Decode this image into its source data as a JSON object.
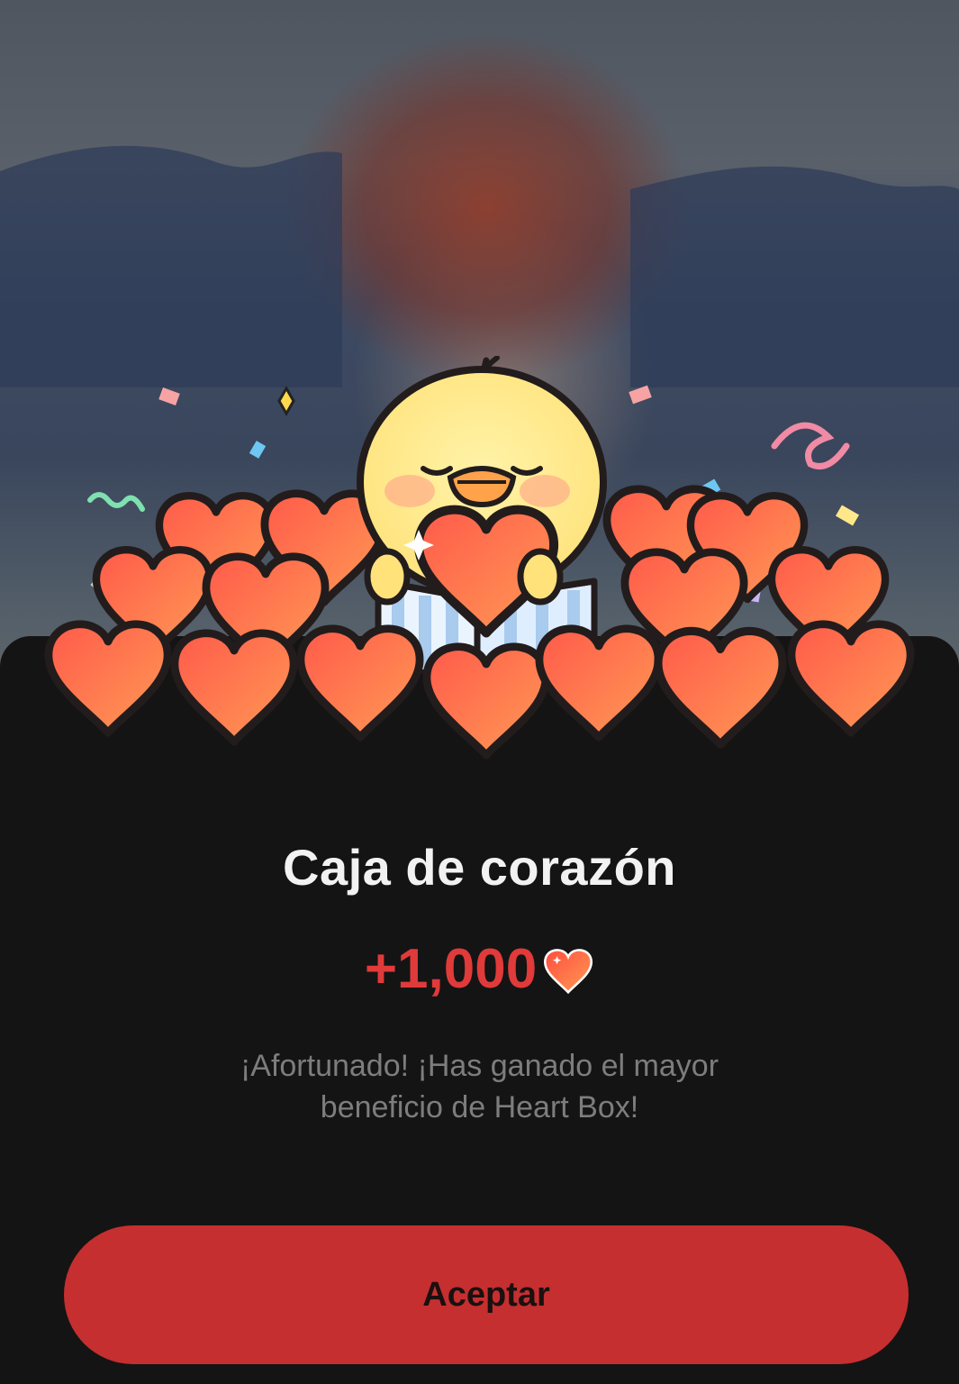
{
  "dialog": {
    "title": "Caja de corazón",
    "reward_amount": "+1,000",
    "reward_icon": "heart-icon",
    "message": "¡Afortunado! ¡Has ganado el mayor beneficio de Heart Box!",
    "accept_label": "Aceptar"
  },
  "colors": {
    "accent": "#c62f2f",
    "reward_text": "#e03a3a",
    "sheet_background": "#141414",
    "title_text": "#f2f2f2",
    "message_text": "#7d7d7d"
  }
}
